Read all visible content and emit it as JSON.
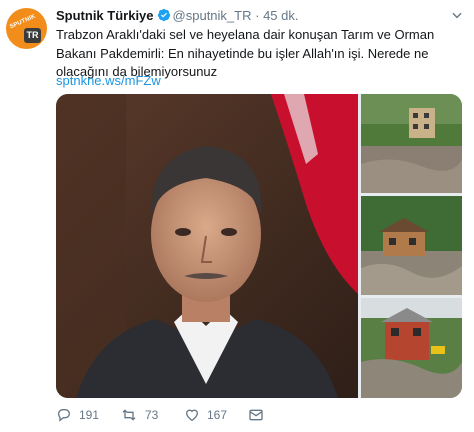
{
  "tweet": {
    "account": {
      "name": "Sputnik Türkiye",
      "handle": "@sputnik_TR",
      "separator": "·",
      "time": "45 dk.",
      "avatar_brand": "SPUTNIK",
      "avatar_badge": "TR"
    },
    "text": "Trabzon Araklı'daki sel ve heyelana dair konuşan Tarım ve Orman Bakanı Pakdemirli: En nihayetinde bu işler Allah'ın işi. Nerede ne olacağını da bilemiyorsunuz",
    "link": "sptnkne.ws/mFZw",
    "media": {
      "photos": [
        "portrait-photo",
        "flood-photo-house",
        "flood-photo-debris",
        "flood-photo-red-house"
      ]
    },
    "actions": {
      "reply_count": "191",
      "retweet_count": "73",
      "like_count": "167"
    },
    "colors": {
      "accent": "#1b95e0",
      "verified": "#1da1f2",
      "muted": "#657786",
      "avatar_bg": "#f28c1a"
    },
    "icons": [
      "chevron-down-icon",
      "verified-icon",
      "reply-icon",
      "retweet-icon",
      "like-icon",
      "message-icon"
    ]
  }
}
